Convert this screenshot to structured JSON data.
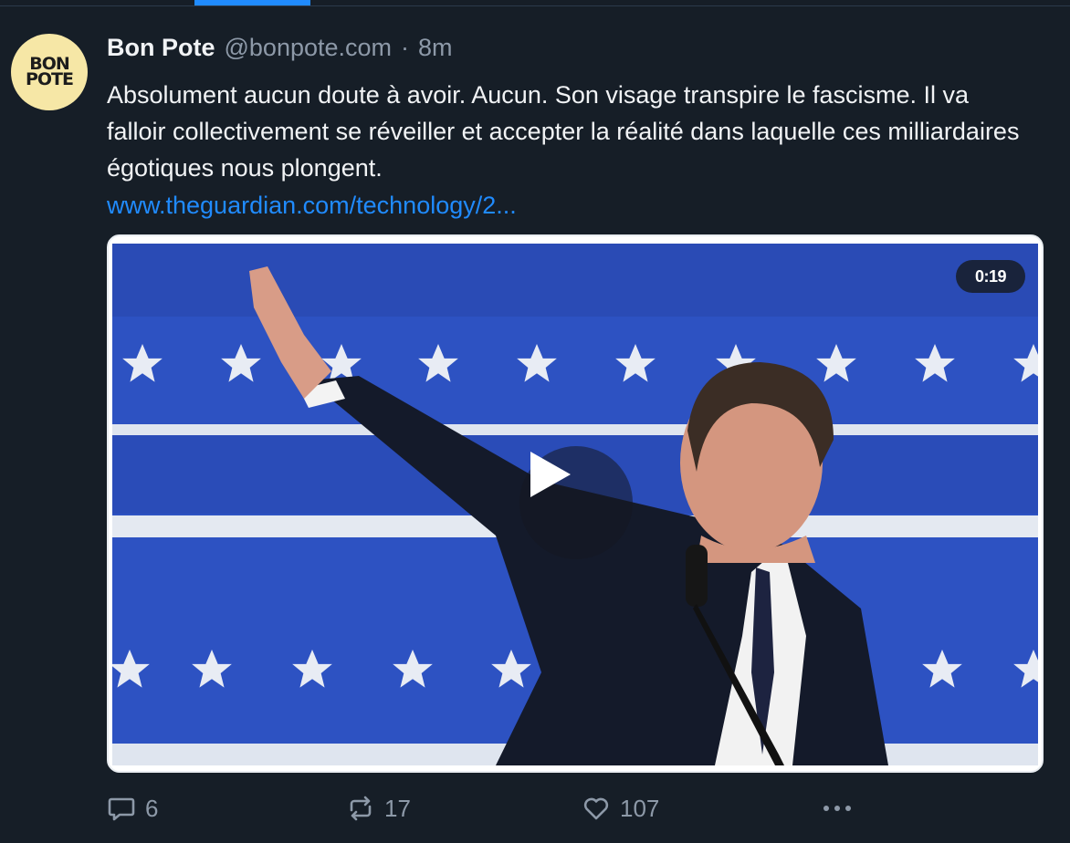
{
  "post": {
    "avatar": {
      "line1": "BON",
      "line2": "POTE",
      "color": "#f6e7a6"
    },
    "author": {
      "display_name": "Bon Pote",
      "handle": "@bonpote.com",
      "separator": "·",
      "time": "8m"
    },
    "text": "Absolument aucun doute à avoir. Aucun. Son visage transpire le fascisme. Il va falloir collectivement se réveiller et accepter la réalité dans laquelle ces milliardaires égotiques nous plongent.",
    "link_text": "www.theguardian.com/technology/2...",
    "media": {
      "duration": "0:19",
      "play_icon": "play-icon"
    },
    "actions": {
      "replies": "6",
      "reposts": "17",
      "likes": "107",
      "more_icon": "more-icon"
    }
  },
  "colors": {
    "background": "#161e27",
    "accent": "#208bfe",
    "muted_text": "#8d99a8",
    "text": "#f1f3f5"
  }
}
